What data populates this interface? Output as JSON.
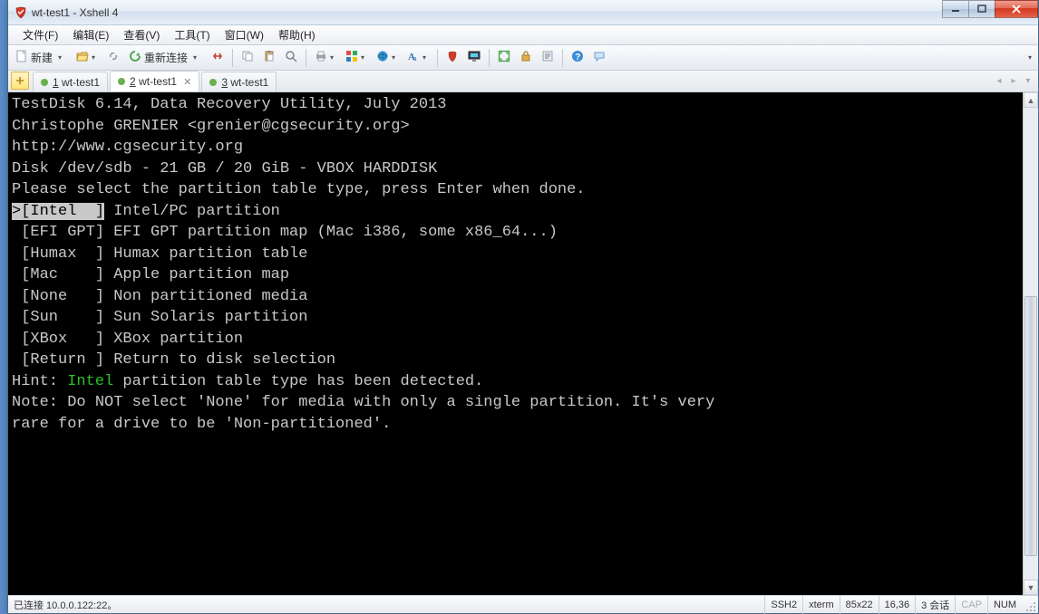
{
  "window": {
    "title": "wt-test1 - Xshell 4"
  },
  "menu": {
    "file": "文件(F)",
    "edit": "编辑(E)",
    "view": "查看(V)",
    "tools": "工具(T)",
    "window": "窗口(W)",
    "help": "帮助(H)"
  },
  "toolbar": {
    "new_label": "新建",
    "reconnect_label": "重新连接"
  },
  "tabs": {
    "items": [
      {
        "index": "1",
        "label": "wt-test1",
        "active": false,
        "closable": false
      },
      {
        "index": "2",
        "label": "wt-test1",
        "active": true,
        "closable": true
      },
      {
        "index": "3",
        "label": "wt-test1",
        "active": false,
        "closable": false
      }
    ]
  },
  "terminal": {
    "lines": [
      "TestDisk 6.14, Data Recovery Utility, July 2013",
      "Christophe GRENIER <grenier@cgsecurity.org>",
      "http://www.cgsecurity.org",
      "",
      "",
      "Disk /dev/sdb - 21 GB / 20 GiB - VBOX HARDDISK",
      "",
      "Please select the partition table type, press Enter when done.",
      "",
      " [EFI GPT] EFI GPT partition map (Mac i386, some x86_64...)",
      " [Humax  ] Humax partition table",
      " [Mac    ] Apple partition map",
      " [None   ] Non partitioned media",
      " [Sun    ] Sun Solaris partition",
      " [XBox   ] XBox partition",
      " [Return ] Return to disk selection",
      "",
      "",
      ""
    ],
    "selected_label": ">[Intel  ]",
    "selected_desc": " Intel/PC partition",
    "hint_prefix": "Hint: ",
    "hint_highlight": "Intel",
    "hint_rest": " partition table type has been detected.",
    "note1": "Note: Do NOT select 'None' for media with only a single partition. It's very",
    "note2": "rare for a drive to be 'Non-partitioned'."
  },
  "status": {
    "left": "已连接 10.0.0.122:22。",
    "protocol": "SSH2",
    "term": "xterm",
    "size": "85x22",
    "cursor": "16,36",
    "sessions": "3 会话",
    "cap": "CAP",
    "num": "NUM"
  }
}
